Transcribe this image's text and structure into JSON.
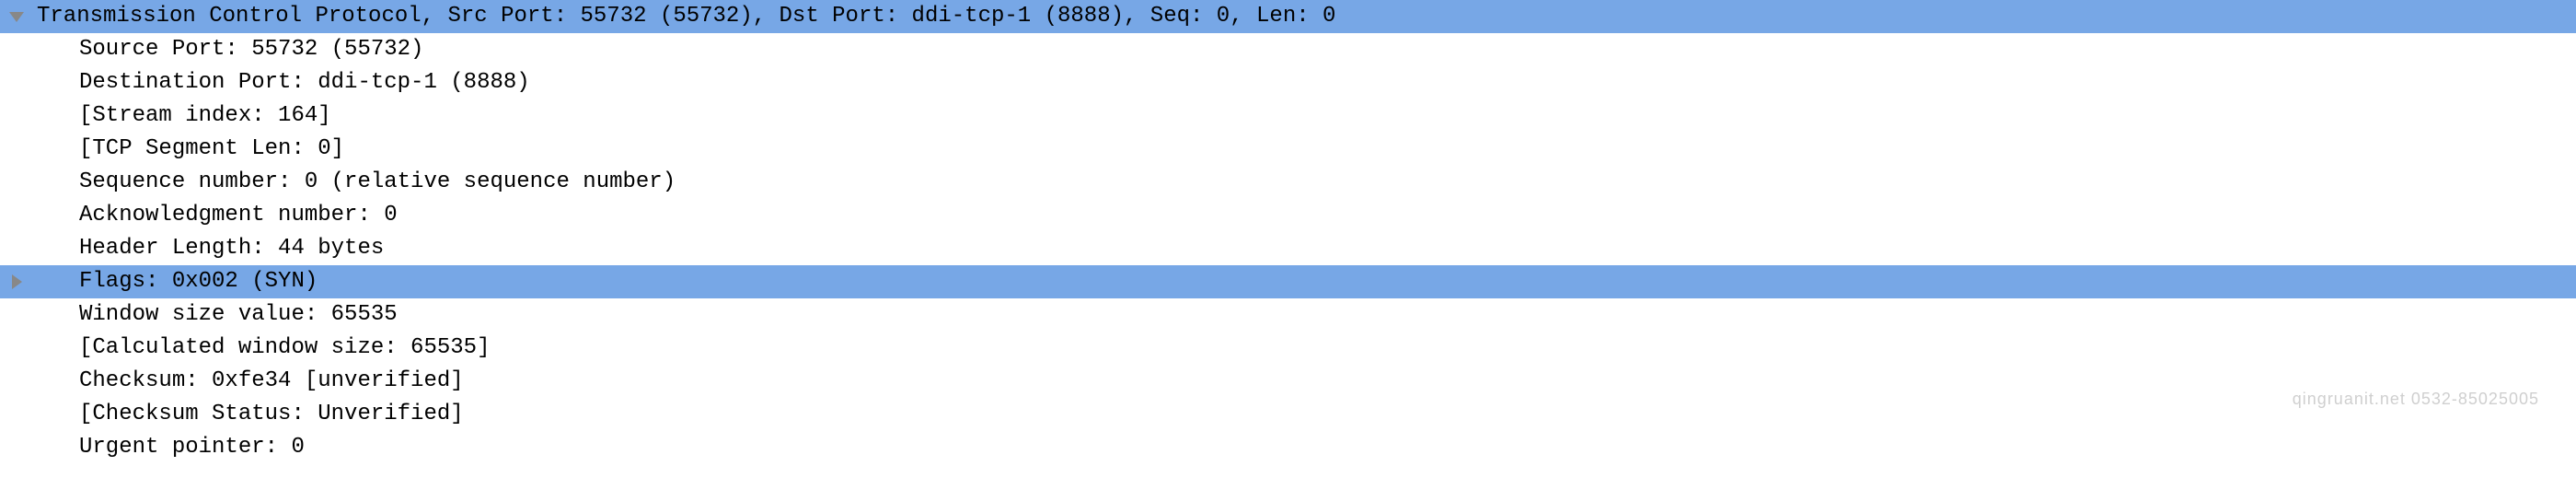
{
  "tcp": {
    "header": "Transmission Control Protocol, Src Port: 55732 (55732), Dst Port: ddi-tcp-1 (8888), Seq: 0, Len: 0",
    "src_port": "Source Port: 55732 (55732)",
    "dst_port": "Destination Port: ddi-tcp-1 (8888)",
    "stream_index": "[Stream index: 164]",
    "seg_len": "[TCP Segment Len: 0]",
    "seq_num": "Sequence number: 0    (relative sequence number)",
    "ack_num": "Acknowledgment number: 0",
    "hdr_len": "Header Length: 44 bytes",
    "flags": "Flags: 0x002 (SYN)",
    "win_size": "Window size value: 65535",
    "calc_win": "[Calculated window size: 65535]",
    "checksum": "Checksum: 0xfe34 [unverified]",
    "checksum_status": "[Checksum Status: Unverified]",
    "urgent": "Urgent pointer: 0"
  },
  "watermark": "qingruanit.net 0532-85025005"
}
